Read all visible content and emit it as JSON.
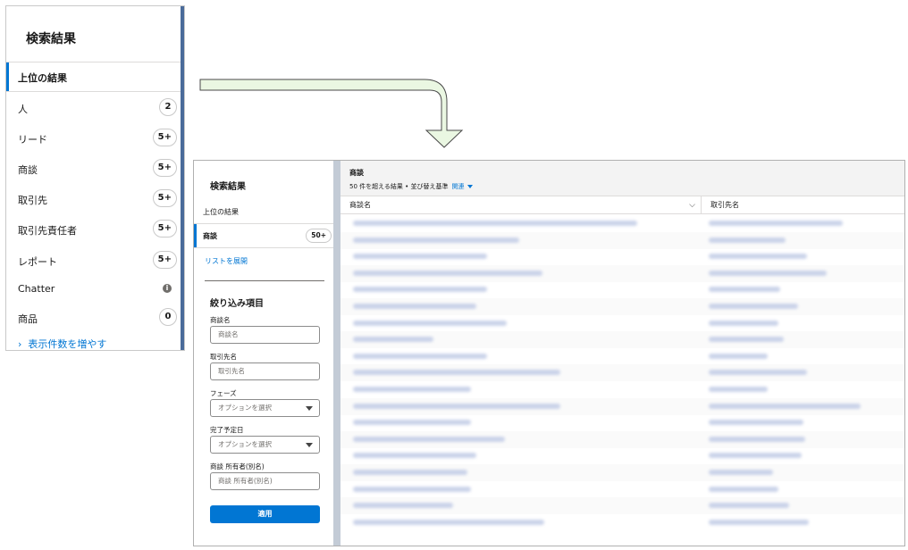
{
  "before_panel": {
    "title": "検索結果",
    "top_results": "上位の結果",
    "items": [
      {
        "label": "人",
        "count": "2"
      },
      {
        "label": "リード",
        "count": "5+"
      },
      {
        "label": "商談",
        "count": "5+"
      },
      {
        "label": "取引先",
        "count": "5+"
      },
      {
        "label": "取引先責任者",
        "count": "5+"
      },
      {
        "label": "レポート",
        "count": "5+"
      },
      {
        "label": "Chatter",
        "count": ""
      },
      {
        "label": "商品",
        "count": "0"
      }
    ],
    "show_more": "表示件数を増やす"
  },
  "after_window": {
    "sidebar": {
      "title": "検索結果",
      "top_results": "上位の結果",
      "selected_item": {
        "label": "商談",
        "count": "50+"
      },
      "expand_list": "リストを展開",
      "filter_title": "絞り込み項目",
      "filters": [
        {
          "label": "商談名",
          "placeholder": "商談名",
          "type": "text"
        },
        {
          "label": "取引先名",
          "placeholder": "取引先名",
          "type": "text"
        },
        {
          "label": "フェーズ",
          "placeholder": "オプションを選択",
          "type": "select"
        },
        {
          "label": "完了予定日",
          "placeholder": "オプションを選択",
          "type": "select"
        },
        {
          "label": "商談 所有者(別名)",
          "placeholder": "商談 所有者(別名)",
          "type": "text"
        }
      ],
      "apply_label": "適用"
    },
    "main": {
      "title": "商談",
      "subtitle": "50 件を超える結果 • 並び替え基準",
      "sort_by": "関連",
      "columns": [
        "商談名",
        "取引先名"
      ]
    }
  },
  "colors": {
    "accent": "#0176d3",
    "arrow_fill": "#eaf7e2",
    "arrow_stroke": "#4a4a4a"
  }
}
